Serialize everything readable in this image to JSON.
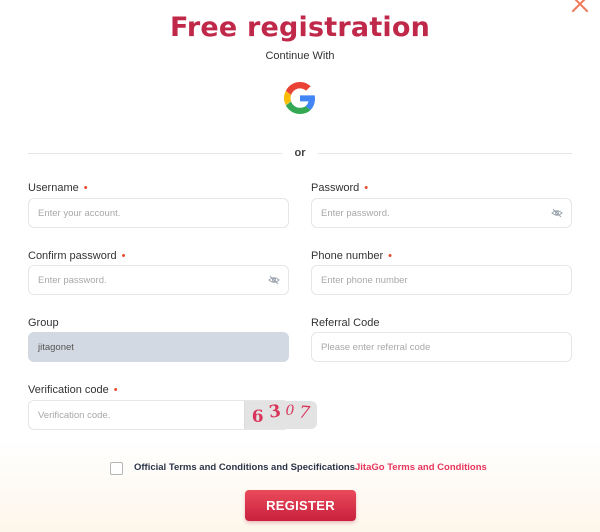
{
  "header": {
    "title": "Free registration",
    "subtitle": "Continue With",
    "divider_text": "or"
  },
  "icons": {
    "close": "close-icon",
    "google": "google-icon",
    "eye": "eye-slash-icon"
  },
  "colors": {
    "brand": "#c0284a",
    "required": "#e8472b",
    "link": "#e8355a",
    "group_bg": "#d3d9e2"
  },
  "form": {
    "username": {
      "label": "Username",
      "placeholder": "Enter your account."
    },
    "password": {
      "label": "Password",
      "placeholder": "Enter password."
    },
    "confirm_password": {
      "label": "Confirm password",
      "placeholder": "Enter password."
    },
    "phone": {
      "label": "Phone number",
      "placeholder": "Enter phone number"
    },
    "group": {
      "label": "Group",
      "value": "jitagonet"
    },
    "referral": {
      "label": "Referral Code",
      "placeholder": "Please enter referral code"
    },
    "verification": {
      "label": "Verification code",
      "placeholder": "Verification code.",
      "captcha": [
        "6",
        "3",
        "0",
        "7"
      ]
    },
    "required_mark": "•"
  },
  "terms": {
    "text": "Official Terms and Conditions and Specifications",
    "link": "JitaGo Terms and Conditions"
  },
  "register_label": "REGISTER"
}
